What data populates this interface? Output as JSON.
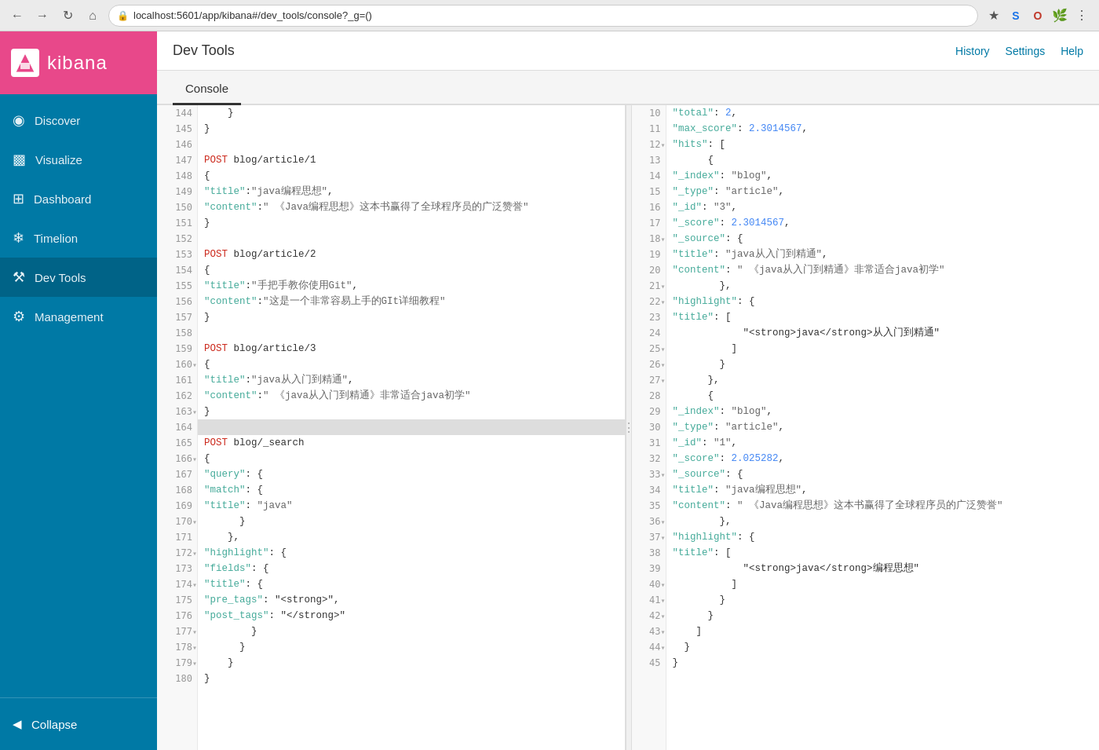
{
  "browser": {
    "url": "localhost:5601/app/kibana#/dev_tools/console?_g=()",
    "back_disabled": false,
    "forward_disabled": true
  },
  "app": {
    "title": "Dev Tools",
    "logo_text": "kibana",
    "tab": "Console"
  },
  "topbar": {
    "title": "Dev Tools",
    "history_label": "History",
    "settings_label": "Settings",
    "help_label": "Help"
  },
  "sidebar": {
    "items": [
      {
        "id": "discover",
        "label": "Discover",
        "icon": "◎"
      },
      {
        "id": "visualize",
        "label": "Visualize",
        "icon": "▮"
      },
      {
        "id": "dashboard",
        "label": "Dashboard",
        "icon": "⊟"
      },
      {
        "id": "timelion",
        "label": "Timelion",
        "icon": "❄"
      },
      {
        "id": "devtools",
        "label": "Dev Tools",
        "icon": "✦"
      },
      {
        "id": "management",
        "label": "Management",
        "icon": "⚙"
      }
    ],
    "collapse_label": "Collapse"
  },
  "editor": {
    "lines": [
      {
        "num": 144,
        "arrow": false,
        "content": "    }"
      },
      {
        "num": 145,
        "arrow": false,
        "content": "}"
      },
      {
        "num": 146,
        "arrow": false,
        "content": ""
      },
      {
        "num": 147,
        "arrow": false,
        "content": "POST blog/article/1",
        "type": "request"
      },
      {
        "num": 148,
        "arrow": false,
        "content": "{"
      },
      {
        "num": 149,
        "arrow": false,
        "content": "    \"title\":\"java编程思想\","
      },
      {
        "num": 150,
        "arrow": false,
        "content": "    \"content\":\" 《Java编程思想》这本书赢得了全球程序员的广泛赞誉\""
      },
      {
        "num": 151,
        "arrow": false,
        "content": "}"
      },
      {
        "num": 152,
        "arrow": false,
        "content": ""
      },
      {
        "num": 153,
        "arrow": false,
        "content": "POST blog/article/2",
        "type": "request"
      },
      {
        "num": 154,
        "arrow": false,
        "content": "{"
      },
      {
        "num": 155,
        "arrow": false,
        "content": "    \"title\":\"手把手教你使用Git\","
      },
      {
        "num": 156,
        "arrow": false,
        "content": "    \"content\":\"这是一个非常容易上手的GIt详细教程\""
      },
      {
        "num": 157,
        "arrow": false,
        "content": "}"
      },
      {
        "num": 158,
        "arrow": false,
        "content": ""
      },
      {
        "num": 159,
        "arrow": false,
        "content": "POST blog/article/3",
        "type": "request"
      },
      {
        "num": 160,
        "arrow": true,
        "content": "{"
      },
      {
        "num": 161,
        "arrow": false,
        "content": "    \"title\":\"java从入门到精通\","
      },
      {
        "num": 162,
        "arrow": false,
        "content": "    \"content\":\" 《java从入门到精通》非常适合java初学\""
      },
      {
        "num": 163,
        "arrow": true,
        "content": "}"
      },
      {
        "num": 164,
        "arrow": false,
        "content": "",
        "active": true
      },
      {
        "num": 165,
        "arrow": false,
        "content": "POST blog/_search",
        "type": "request"
      },
      {
        "num": 166,
        "arrow": true,
        "content": "{"
      },
      {
        "num": 167,
        "arrow": false,
        "content": "    \"query\": {"
      },
      {
        "num": 168,
        "arrow": false,
        "content": "      \"match\": {"
      },
      {
        "num": 169,
        "arrow": false,
        "content": "        \"title\": \"java\""
      },
      {
        "num": 170,
        "arrow": true,
        "content": "      }"
      },
      {
        "num": 171,
        "arrow": false,
        "content": "    },"
      },
      {
        "num": 172,
        "arrow": true,
        "content": "    \"highlight\": {"
      },
      {
        "num": 173,
        "arrow": false,
        "content": "      \"fields\": {"
      },
      {
        "num": 174,
        "arrow": true,
        "content": "        \"title\": {"
      },
      {
        "num": 175,
        "arrow": false,
        "content": "          \"pre_tags\": \"<strong>\","
      },
      {
        "num": 176,
        "arrow": false,
        "content": "          \"post_tags\": \"</strong>\""
      },
      {
        "num": 177,
        "arrow": true,
        "content": "        }"
      },
      {
        "num": 178,
        "arrow": true,
        "content": "      }"
      },
      {
        "num": 179,
        "arrow": true,
        "content": "    }"
      },
      {
        "num": 180,
        "arrow": false,
        "content": "}"
      }
    ]
  },
  "output": {
    "lines": [
      {
        "num": 10,
        "arrow": false,
        "content": "    \"total\": 2,"
      },
      {
        "num": 11,
        "arrow": false,
        "content": "    \"max_score\": 2.3014567,"
      },
      {
        "num": 12,
        "arrow": true,
        "content": "    \"hits\": ["
      },
      {
        "num": 13,
        "arrow": false,
        "content": "      {"
      },
      {
        "num": 14,
        "arrow": false,
        "content": "        \"_index\": \"blog\","
      },
      {
        "num": 15,
        "arrow": false,
        "content": "        \"_type\": \"article\","
      },
      {
        "num": 16,
        "arrow": false,
        "content": "        \"_id\": \"3\","
      },
      {
        "num": 17,
        "arrow": false,
        "content": "        \"_score\": 2.3014567,"
      },
      {
        "num": 18,
        "arrow": true,
        "content": "        \"_source\": {"
      },
      {
        "num": 19,
        "arrow": false,
        "content": "          \"title\": \"java从入门到精通\","
      },
      {
        "num": 20,
        "arrow": false,
        "content": "          \"content\": \" 《java从入门到精通》非常适合java初学\""
      },
      {
        "num": 21,
        "arrow": true,
        "content": "        },"
      },
      {
        "num": 22,
        "arrow": true,
        "content": "        \"highlight\": {"
      },
      {
        "num": 23,
        "arrow": false,
        "content": "          \"title\": ["
      },
      {
        "num": 24,
        "arrow": false,
        "content": "            \"<strong>java</strong>从入门到精通\""
      },
      {
        "num": 25,
        "arrow": true,
        "content": "          ]"
      },
      {
        "num": 26,
        "arrow": true,
        "content": "        }"
      },
      {
        "num": 27,
        "arrow": true,
        "content": "      },"
      },
      {
        "num": 28,
        "arrow": false,
        "content": "      {"
      },
      {
        "num": 29,
        "arrow": false,
        "content": "        \"_index\": \"blog\","
      },
      {
        "num": 30,
        "arrow": false,
        "content": "        \"_type\": \"article\","
      },
      {
        "num": 31,
        "arrow": false,
        "content": "        \"_id\": \"1\","
      },
      {
        "num": 32,
        "arrow": false,
        "content": "        \"_score\": 2.025282,"
      },
      {
        "num": 33,
        "arrow": true,
        "content": "        \"_source\": {"
      },
      {
        "num": 34,
        "arrow": false,
        "content": "          \"title\": \"java编程思想\","
      },
      {
        "num": 35,
        "arrow": false,
        "content": "          \"content\": \" 《Java编程思想》这本书赢得了全球程序员的广泛赞誉\""
      },
      {
        "num": 36,
        "arrow": true,
        "content": "        },"
      },
      {
        "num": 37,
        "arrow": true,
        "content": "        \"highlight\": {"
      },
      {
        "num": 38,
        "arrow": false,
        "content": "          \"title\": ["
      },
      {
        "num": 39,
        "arrow": false,
        "content": "            \"<strong>java</strong>编程思想\""
      },
      {
        "num": 40,
        "arrow": true,
        "content": "          ]"
      },
      {
        "num": 41,
        "arrow": true,
        "content": "        }"
      },
      {
        "num": 42,
        "arrow": true,
        "content": "      }"
      },
      {
        "num": 43,
        "arrow": true,
        "content": "    ]"
      },
      {
        "num": 44,
        "arrow": true,
        "content": "  }"
      },
      {
        "num": 45,
        "arrow": false,
        "content": "}"
      }
    ]
  }
}
